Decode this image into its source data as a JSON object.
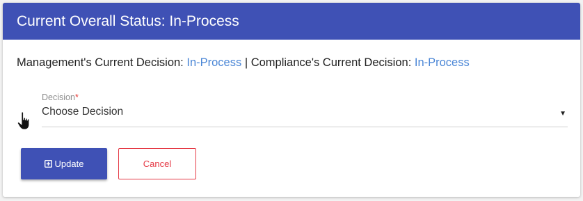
{
  "header": {
    "title": "Current Overall Status: In-Process"
  },
  "status": {
    "management_label": "Management's Current Decision:",
    "management_value": "In-Process",
    "separator": "|",
    "compliance_label": "Compliance's Current Decision:",
    "compliance_value": "In-Process"
  },
  "decision": {
    "label": "Decision",
    "required_mark": "*",
    "selected": "Choose Decision"
  },
  "buttons": {
    "update_label": "Update",
    "cancel_label": "Cancel"
  },
  "icons": {
    "update": "plus-square-icon",
    "dropdown": "caret-down-icon",
    "cursor": "hand-pointer-icon"
  },
  "colors": {
    "primary": "#3f51b5",
    "link": "#4a86d6",
    "danger": "#e53945"
  }
}
